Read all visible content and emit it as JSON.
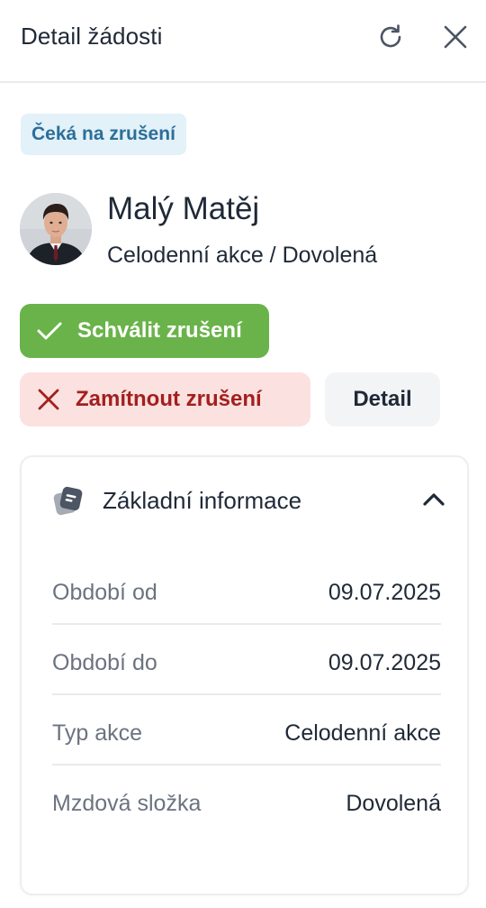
{
  "header": {
    "title": "Detail žádosti",
    "refresh_icon": "refresh-icon",
    "close_icon": "close-icon"
  },
  "status": {
    "label": "Čeká na zrušení",
    "color": "#2b6f99",
    "background": "#e3f1f8"
  },
  "person": {
    "name": "Malý Matěj",
    "subtitle": "Celodenní akce / Dovolená"
  },
  "actions": {
    "approve_label": "Schválit zrušení",
    "approve_icon": "check-icon",
    "approve_color": "#6ab34a",
    "reject_label": "Zamítnout zrušení",
    "reject_icon": "x-icon",
    "reject_color": "#a31f1f",
    "detail_label": "Detail"
  },
  "card": {
    "title": "Základní informace",
    "icon": "document-tag-icon",
    "chevron": "chevron-up-icon",
    "rows": [
      {
        "label": "Období od",
        "value": "09.07.2025"
      },
      {
        "label": "Období do",
        "value": "09.07.2025"
      },
      {
        "label": "Typ akce",
        "value": "Celodenní akce"
      },
      {
        "label": "Mzdová složka",
        "value": "Dovolená"
      }
    ]
  }
}
